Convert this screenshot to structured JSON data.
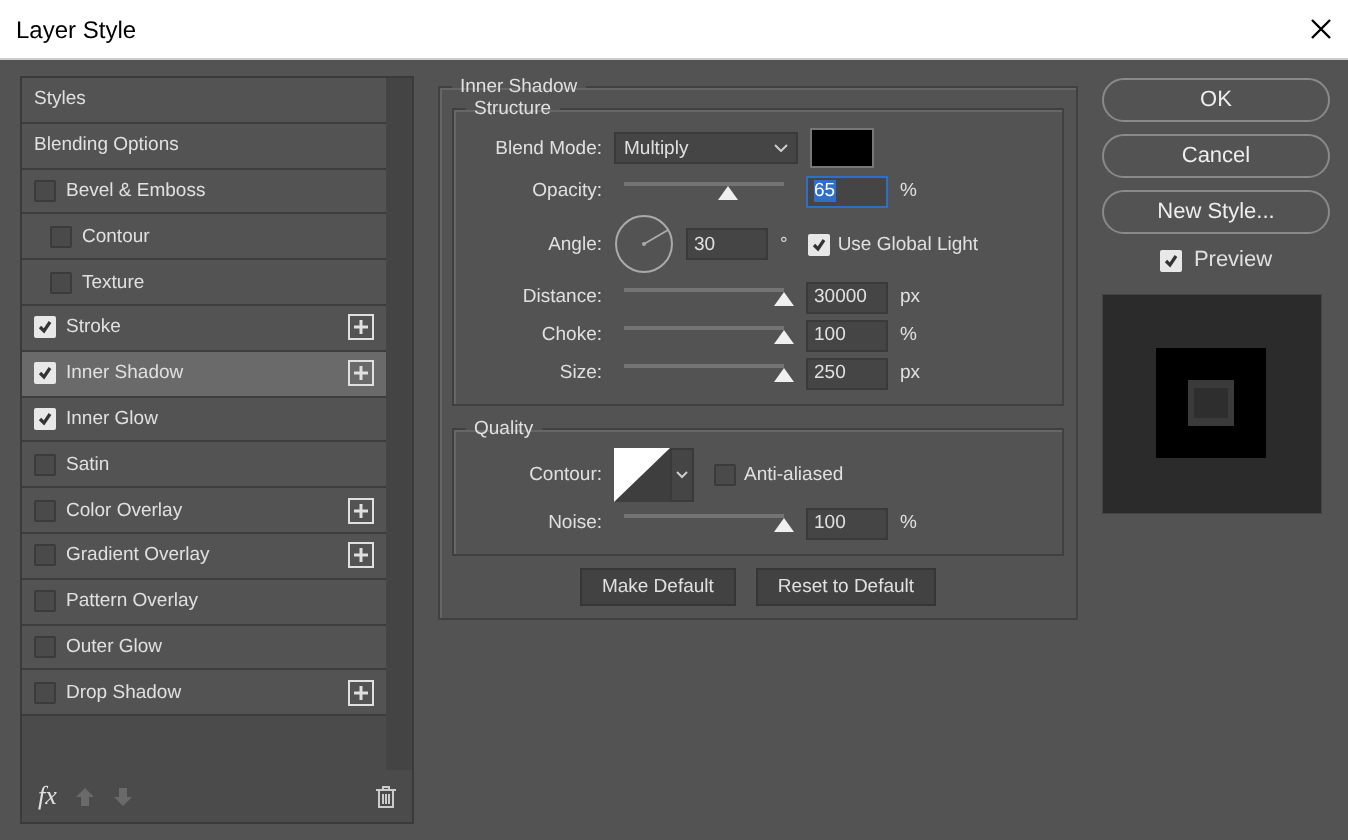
{
  "window": {
    "title": "Layer Style"
  },
  "styles_list": [
    {
      "kind": "header",
      "label": "Styles",
      "selected": false
    },
    {
      "kind": "header",
      "label": "Blending Options",
      "selected": false
    },
    {
      "kind": "effect",
      "label": "Bevel & Emboss",
      "checked": false,
      "selected": false,
      "add_button": false,
      "children": [
        {
          "kind": "effect",
          "label": "Contour",
          "checked": false,
          "selected": false,
          "add_button": false
        },
        {
          "kind": "effect",
          "label": "Texture",
          "checked": false,
          "selected": false,
          "add_button": false
        }
      ]
    },
    {
      "kind": "effect",
      "label": "Stroke",
      "checked": true,
      "selected": false,
      "add_button": true
    },
    {
      "kind": "effect",
      "label": "Inner Shadow",
      "checked": true,
      "selected": true,
      "add_button": true
    },
    {
      "kind": "effect",
      "label": "Inner Glow",
      "checked": true,
      "selected": false,
      "add_button": false
    },
    {
      "kind": "effect",
      "label": "Satin",
      "checked": false,
      "selected": false,
      "add_button": false
    },
    {
      "kind": "effect",
      "label": "Color Overlay",
      "checked": false,
      "selected": false,
      "add_button": true
    },
    {
      "kind": "effect",
      "label": "Gradient Overlay",
      "checked": false,
      "selected": false,
      "add_button": true
    },
    {
      "kind": "effect",
      "label": "Pattern Overlay",
      "checked": false,
      "selected": false,
      "add_button": false
    },
    {
      "kind": "effect",
      "label": "Outer Glow",
      "checked": false,
      "selected": false,
      "add_button": false
    },
    {
      "kind": "effect",
      "label": "Drop Shadow",
      "checked": false,
      "selected": false,
      "add_button": true
    }
  ],
  "list_toolbar": {
    "effects_label": "fx"
  },
  "panel": {
    "title": "Inner Shadow",
    "structure": {
      "title": "Structure",
      "blend_mode": {
        "label": "Blend Mode:",
        "value": "Multiply"
      },
      "opacity": {
        "label": "Opacity:",
        "level": 0.65,
        "value": "65",
        "unit": "%",
        "text_selected": true
      },
      "angle": {
        "label": "Angle:",
        "value": "30",
        "unit": "°",
        "use_global_light": {
          "label": "Use Global Light",
          "checked": true
        }
      },
      "sliders": [
        {
          "label": "Distance:",
          "level": 1,
          "value": "30000",
          "unit": "px"
        },
        {
          "label": "Choke:",
          "level": 1,
          "value": "100",
          "unit": "%"
        },
        {
          "label": "Size:",
          "level": 1,
          "value": "250",
          "unit": "px"
        }
      ]
    },
    "quality": {
      "title": "Quality",
      "contour": {
        "label": "Contour:",
        "anti_aliased": {
          "label": "Anti-aliased",
          "checked": false
        }
      },
      "noise": {
        "label": "Noise:",
        "level": 1,
        "value": "100",
        "unit": "%"
      }
    },
    "buttons": [
      "Make Default",
      "Reset to Default"
    ]
  },
  "actions": [
    "OK",
    "Cancel",
    "New Style..."
  ],
  "preview": {
    "label": "Preview",
    "checked": true
  }
}
